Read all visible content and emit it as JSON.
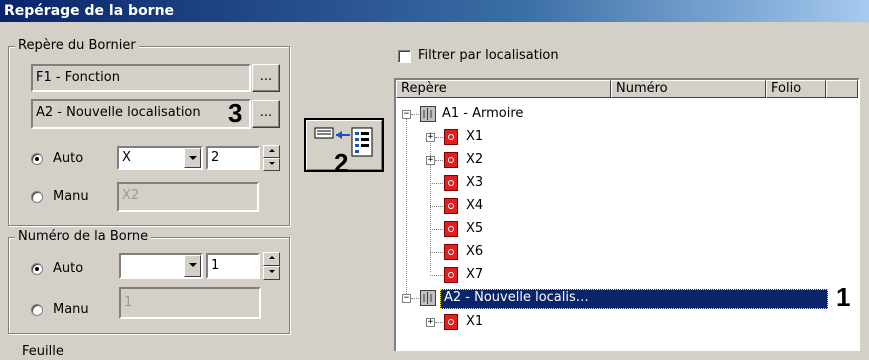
{
  "window": {
    "title": "Repérage de la borne"
  },
  "bornier_group": {
    "legend": "Repère du Bornier",
    "fonction_value": "F1 - Fonction",
    "localisation_value": "A2 - Nouvelle localisation",
    "browse_label": "...",
    "auto_label": "Auto",
    "auto_combo_value": "X",
    "auto_spin_value": "2",
    "manu_label": "Manu",
    "manu_value": "X2"
  },
  "numero_group": {
    "legend": "Numéro de la Borne",
    "auto_label": "Auto",
    "auto_combo_value": "",
    "auto_spin_value": "1",
    "manu_label": "Manu",
    "manu_value": "1"
  },
  "feuille_label": "Feuille",
  "filter": {
    "label": "Filtrer par localisation",
    "checked": false
  },
  "tree": {
    "columns": [
      "Repère",
      "Numéro",
      "Folio"
    ],
    "nodes": [
      {
        "label": "A1 - Armoire",
        "icon": "cabinet-icon",
        "level": 0,
        "expanded": true
      },
      {
        "label": "X1",
        "icon": "terminal-icon",
        "level": 1,
        "expandable": true
      },
      {
        "label": "X2",
        "icon": "terminal-icon",
        "level": 1,
        "expandable": true
      },
      {
        "label": "X3",
        "icon": "terminal-icon",
        "level": 1
      },
      {
        "label": "X4",
        "icon": "terminal-icon",
        "level": 1
      },
      {
        "label": "X5",
        "icon": "terminal-icon",
        "level": 1
      },
      {
        "label": "X6",
        "icon": "terminal-icon",
        "level": 1
      },
      {
        "label": "X7",
        "icon": "terminal-icon",
        "level": 1
      },
      {
        "label": "A2 - Nouvelle localis…",
        "icon": "cabinet-icon",
        "level": 0,
        "expanded": true,
        "selected": true
      },
      {
        "label": "X1",
        "icon": "terminal-icon",
        "level": 1,
        "expandable": true
      }
    ]
  },
  "annotations": {
    "m1": "1",
    "m2": "2",
    "m3": "3"
  },
  "colors": {
    "title_bar": "#0a246a",
    "selection": "#0a246a",
    "terminal_icon": "#e02020"
  }
}
